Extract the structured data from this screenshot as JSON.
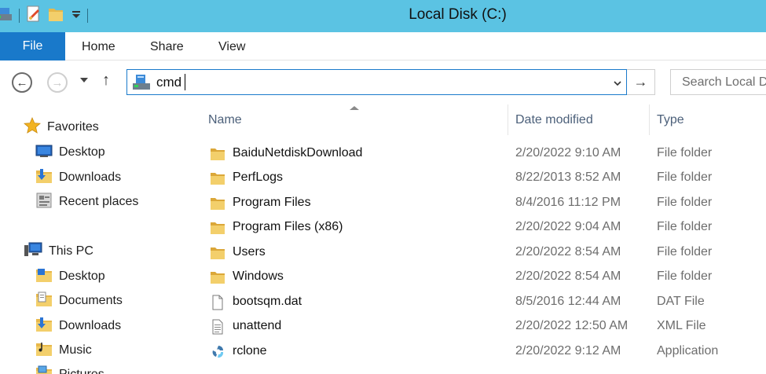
{
  "window": {
    "title": "Local Disk (C:)"
  },
  "ribbon": {
    "tabs": [
      {
        "label": "File"
      },
      {
        "label": "Home"
      },
      {
        "label": "Share"
      },
      {
        "label": "View"
      }
    ]
  },
  "address": {
    "value": "cmd",
    "icon": "console-icon"
  },
  "search": {
    "placeholder": "Search Local D"
  },
  "nav": {
    "favorites": {
      "label": "Favorites",
      "icon": "star-icon"
    },
    "favorites_items": [
      {
        "label": "Desktop",
        "icon": "desktop-icon"
      },
      {
        "label": "Downloads",
        "icon": "downloads-icon"
      },
      {
        "label": "Recent places",
        "icon": "recent-places-icon"
      }
    ],
    "this_pc": {
      "label": "This PC",
      "icon": "computer-icon"
    },
    "pc_items": [
      {
        "label": "Desktop",
        "icon": "desktop-folder-icon"
      },
      {
        "label": "Documents",
        "icon": "documents-icon"
      },
      {
        "label": "Downloads",
        "icon": "downloads-icon"
      },
      {
        "label": "Music",
        "icon": "music-icon"
      },
      {
        "label": "Pictures",
        "icon": "pictures-icon"
      }
    ]
  },
  "list": {
    "columns": {
      "name": "Name",
      "date": "Date modified",
      "type": "Type"
    },
    "sort": "name-ascending",
    "rows": [
      {
        "name": "BaiduNetdiskDownload",
        "date": "2/20/2022 9:10 AM",
        "type": "File folder",
        "icon": "folder-icon"
      },
      {
        "name": "PerfLogs",
        "date": "8/22/2013 8:52 AM",
        "type": "File folder",
        "icon": "folder-icon"
      },
      {
        "name": "Program Files",
        "date": "8/4/2016 11:12 PM",
        "type": "File folder",
        "icon": "folder-icon"
      },
      {
        "name": "Program Files (x86)",
        "date": "2/20/2022 9:04 AM",
        "type": "File folder",
        "icon": "folder-icon"
      },
      {
        "name": "Users",
        "date": "2/20/2022 8:54 AM",
        "type": "File folder",
        "icon": "folder-icon"
      },
      {
        "name": "Windows",
        "date": "2/20/2022 8:54 AM",
        "type": "File folder",
        "icon": "folder-icon"
      },
      {
        "name": "bootsqm.dat",
        "date": "8/5/2016 12:44 AM",
        "type": "DAT File",
        "icon": "file-icon"
      },
      {
        "name": "unattend",
        "date": "2/20/2022 12:50 AM",
        "type": "XML File",
        "icon": "xml-file-icon"
      },
      {
        "name": "rclone",
        "date": "2/20/2022 9:12 AM",
        "type": "Application",
        "icon": "rclone-app-icon"
      }
    ]
  },
  "colors": {
    "titlebar": "#5bc3e3",
    "file_tab": "#1979ca",
    "accent_border": "#1a7acb",
    "folder": "#e8b84a"
  }
}
